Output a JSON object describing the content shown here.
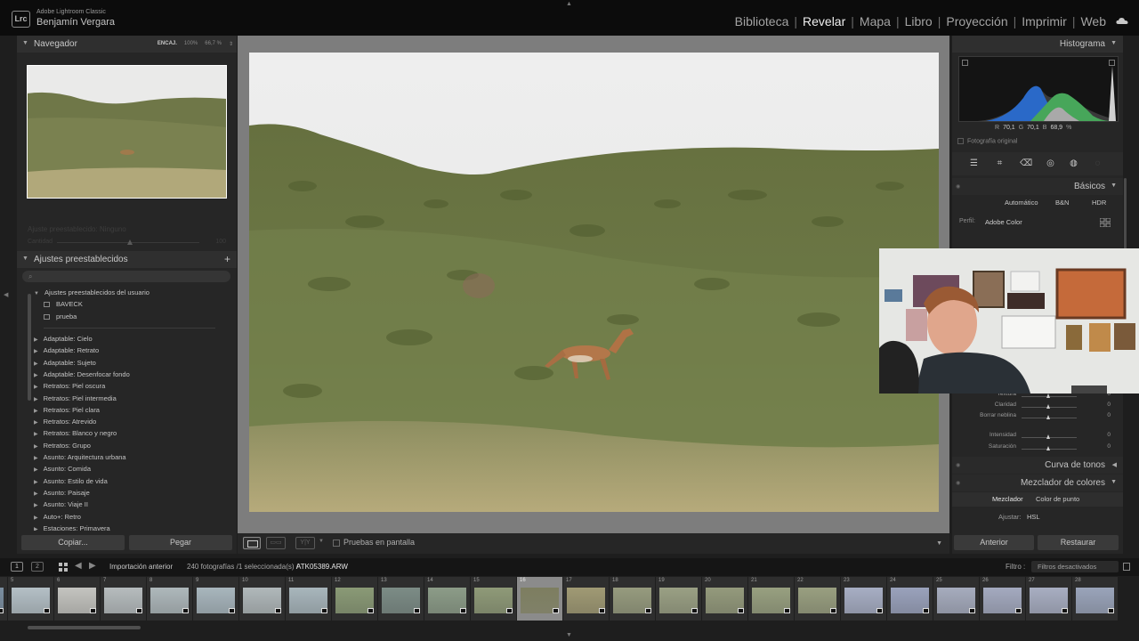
{
  "app": {
    "name": "Adobe Lightroom Classic",
    "user": "Benjamín Vergara",
    "logo": "Lrc",
    "modules": [
      "Biblioteca",
      "Revelar",
      "Mapa",
      "Libro",
      "Proyección",
      "Imprimir",
      "Web"
    ],
    "active_module": "Revelar"
  },
  "left": {
    "navigator": {
      "title": "Navegador",
      "zoom_options": [
        "ENCAJ.",
        "100%",
        "66,7 %"
      ]
    },
    "faded_preset": {
      "label": "Ajuste preestablecido: Ninguno",
      "amount_label": "Cantidad",
      "value": "100"
    },
    "presets": {
      "title": "Ajustes preestablecidos",
      "add": "+",
      "user_group": "Ajustes preestablecidos del usuario",
      "user_items": [
        "BAVECK",
        "prueba"
      ],
      "groups": [
        "Adaptable: Cielo",
        "Adaptable: Retrato",
        "Adaptable: Sujeto",
        "Adaptable: Desenfocar fondo",
        "Retratos: Piel oscura",
        "Retratos: Piel intermedia",
        "Retratos: Piel clara",
        "Retratos: Atrevido",
        "Retratos: Blanco y negro",
        "Retratos: Grupo",
        "Asunto: Arquitectura urbana",
        "Asunto: Comida",
        "Asunto: Estilo de vida",
        "Asunto: Paisaje",
        "Asunto: Viaje II",
        "Auto+: Retro",
        "Estaciones: Primavera"
      ]
    },
    "copy_label": "Copiar...",
    "paste_label": "Pegar"
  },
  "center": {
    "softproof_label": "Pruebas en pantalla"
  },
  "right": {
    "histogram": {
      "title": "Histograma",
      "r_label": "R",
      "r": "70,1",
      "g_label": "G",
      "g": "70,1",
      "b_label": "B",
      "b": "68,9",
      "unit": "%",
      "original_label": "Fotografía original"
    },
    "basic": {
      "title": "Básicos",
      "tabs": [
        "Automático",
        "B&N",
        "HDR"
      ],
      "profile_label": "Perfil:",
      "profile_value": "Adobe Color",
      "sliders": [
        {
          "label": "Textura",
          "value": "0"
        },
        {
          "label": "Claridad",
          "value": "0"
        },
        {
          "label": "Borrar neblina",
          "value": "0"
        },
        {
          "label": "Intensidad",
          "value": "0"
        },
        {
          "label": "Saturación",
          "value": "0"
        }
      ]
    },
    "tone_curve_title": "Curva de tonos",
    "color_mixer": {
      "title": "Mezclador de colores",
      "tabs": [
        "Mezclador",
        "Color de punto"
      ],
      "adjust_label": "Ajustar:",
      "adjust_value": "HSL"
    },
    "prev_label": "Anterior",
    "reset_label": "Restaurar"
  },
  "filmstrip_bar": {
    "monitor1": "1",
    "monitor2": "2",
    "source": "Importación anterior",
    "count": "240 fotografías /1 seleccionada(s) /",
    "file": "ATK05389.ARW",
    "filter_label": "Filtro :",
    "filter_value": "Filtros desactivados"
  },
  "filmstrip": {
    "numbers": [
      "",
      "5",
      "6",
      "7",
      "8",
      "9",
      "10",
      "11",
      "12",
      "13",
      "14",
      "15",
      "16",
      "17",
      "18",
      "19",
      "20",
      "21",
      "22",
      "23",
      "24",
      "25",
      "26",
      "27",
      "28"
    ],
    "selected_index": 12,
    "thumb_colors": [
      "#7b8ea0",
      "#b4c0c6",
      "#c4c4c0",
      "#b6bcbe",
      "#aeb8bb",
      "#a8b6bd",
      "#b0b8ba",
      "#a8b6bc",
      "#8a9a76",
      "#7c8c86",
      "#8c9c88",
      "#8f9a78",
      "#7d7e60",
      "#a09a74",
      "#969b7e",
      "#9aa084",
      "#949a7c",
      "#98a080",
      "#999f80",
      "#a7aec4",
      "#9aa2bc",
      "#a6acbe",
      "#a4aac0",
      "#a8aec2",
      "#9aa4ba"
    ]
  }
}
